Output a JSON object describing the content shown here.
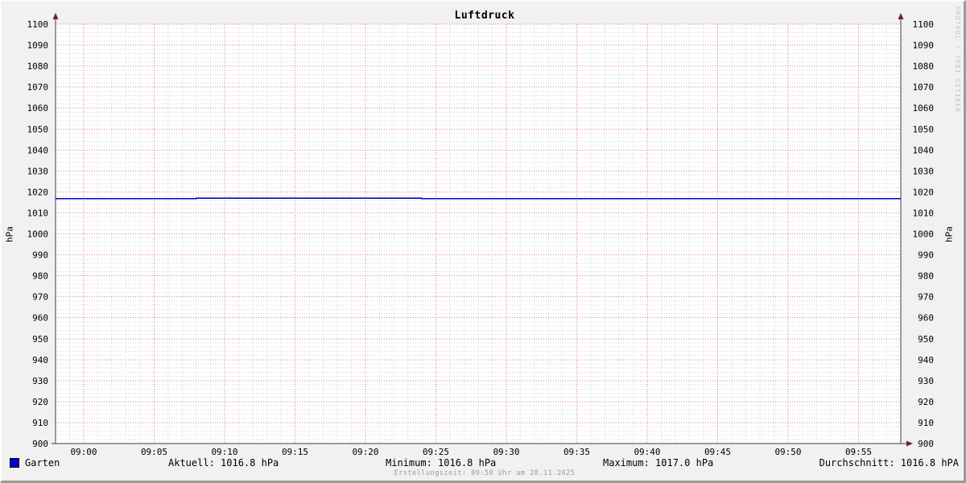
{
  "title": "Luftdruck",
  "watermark": "RRDTOOL / TOBI OETIKER",
  "footer": {
    "created": "Erstellungszeit: 09:58 Uhr am 28.11.2025"
  },
  "legend": {
    "series_label": "Garten",
    "series_color": "#0000cc",
    "stats": [
      {
        "label": "Aktuell",
        "value": "1016.8 hPa",
        "text": "Aktuell: 1016.8 hPa"
      },
      {
        "label": "Minimum",
        "value": "1016.8 hPa",
        "text": "Minimum: 1016.8 hPa"
      },
      {
        "label": "Maximum",
        "value": "1017.0 hPa",
        "text": "Maximum: 1017.0 hPa"
      },
      {
        "label": "Durchschnitt",
        "value": "1016.8 hPA",
        "text": "Durchschnitt: 1016.8 hPA"
      }
    ]
  },
  "chart_data": {
    "type": "line",
    "title": "Luftdruck",
    "ylabel_left": "hPa",
    "ylabel_right": "hPa",
    "ylim": [
      900,
      1100
    ],
    "y_major_step": 10,
    "y_minor_step": 2,
    "x_range": [
      "08:58",
      "09:58"
    ],
    "x_major_ticks": [
      "09:00",
      "09:05",
      "09:10",
      "09:15",
      "09:20",
      "09:25",
      "09:30",
      "09:35",
      "09:40",
      "09:45",
      "09:50",
      "09:55"
    ],
    "x_minor_step_min": 1,
    "grid": true,
    "legend_position": "bottom",
    "colors": {
      "canvas": "#ffffff",
      "background": "#f1f1f1",
      "major_grid": "#e05050",
      "minor_grid": "#d6d6d6",
      "axis": "#3d3d3d",
      "arrow": "#7a1f1f",
      "series": "#0000cc",
      "watermark_text": "#c2c2c2",
      "footer_text": "#9b9b9b"
    },
    "series": [
      {
        "name": "Garten",
        "color": "#0000cc",
        "points": [
          [
            "08:58",
            1016.8
          ],
          [
            "09:08",
            1016.8
          ],
          [
            "09:08",
            1017.0
          ],
          [
            "09:24",
            1017.0
          ],
          [
            "09:24",
            1016.8
          ],
          [
            "09:58",
            1016.8
          ]
        ]
      }
    ],
    "stats": {
      "current": "1016.8 hPa",
      "minimum": "1016.8 hPa",
      "maximum": "1017.0 hPa",
      "average": "1016.8 hPA"
    }
  }
}
